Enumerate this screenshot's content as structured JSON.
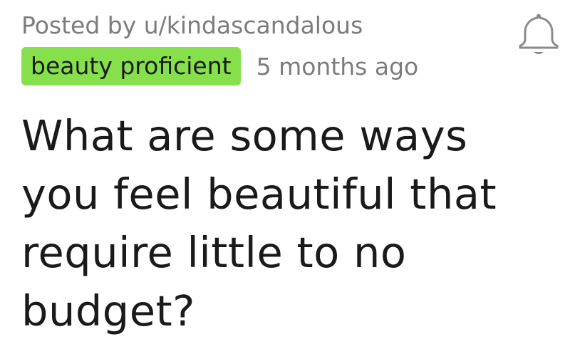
{
  "post": {
    "posted_by": "Posted by u/kindascandalous",
    "flair": "beauty proficient",
    "timestamp": "5 months ago",
    "title_lines": [
      "What are some ways",
      "you feel beautiful that",
      "require little to no",
      "budget?"
    ]
  },
  "icons": {
    "notification": "bell-icon"
  },
  "colors": {
    "flair_background": "#86e04b",
    "meta_text": "#7c7c7c",
    "title_text": "#1a1a1b"
  }
}
